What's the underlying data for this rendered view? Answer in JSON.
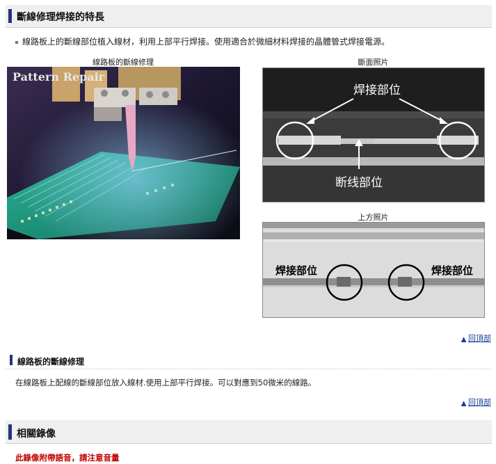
{
  "section1": {
    "title": "斷線修理焊接的特長",
    "bullet": "線路板上的斷線部位植入線材，利用上部平行焊接。使用適合於微細材料焊接的晶體管式焊接電源。",
    "caption_left": "線路板的斷線修理",
    "caption_right_top": "斷面照片",
    "caption_right_bottom": "上方照片",
    "photo_left_overlay": "Pattern Repair",
    "cross_section": {
      "label_weld": "焊接部位",
      "label_break": "断线部位"
    },
    "top_view": {
      "label_left": "焊接部位",
      "label_right": "焊接部位"
    },
    "back_to_top": "回頂部"
  },
  "section2": {
    "title": "線路板的斷線修理",
    "description": "在線路板上配線的斷線部位放入線材.使用上部平行焊接。可以對應到50微米的線路。",
    "back_to_top": "回頂部"
  },
  "section3": {
    "title": "相關錄像",
    "warning": "此錄像附帶語音，請注意音量"
  },
  "colors": {
    "accent_bar": "#23337e",
    "link": "#1a3d9a",
    "warning": "#c00000"
  },
  "icons": {
    "back_to_top": "triangle-up-icon",
    "bullet": "square-bullet-icon"
  }
}
